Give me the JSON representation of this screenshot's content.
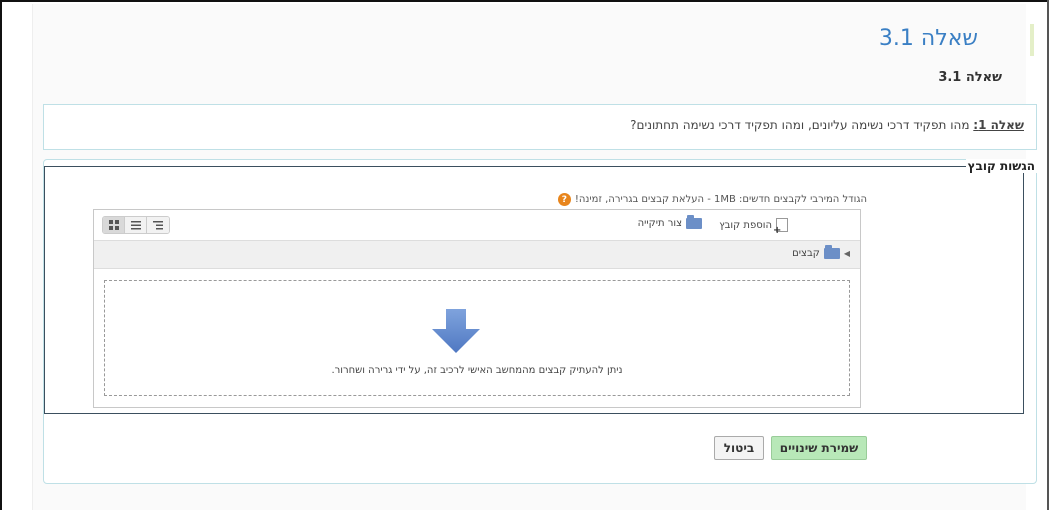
{
  "page": {
    "title": "שאלה 3.1",
    "subtitle": "שאלה 3.1"
  },
  "question": {
    "label": "שאלה 1:",
    "text": " מהו תפקיד דרכי נשימה עליונים, ומהו תפקיד דרכי נשימה תחתונים?"
  },
  "submission": {
    "legend": "הגשות קובץ",
    "size_note": "הגודל המירבי לקבצים חדשים: 1MB - העלאת קבצים בגרירה, זמינה!",
    "help_icon": "?",
    "toolbar": {
      "add_file": "הוספת קובץ",
      "create_folder": "צור תיקייה"
    },
    "path": {
      "folder": "קבצים"
    },
    "drop_text": "ניתן להעתיק קבצים מהמחשב האישי לרכיב זה, על ידי גרירה ושחרור."
  },
  "actions": {
    "save": "שמירת שינויים",
    "cancel": "ביטול"
  },
  "colors": {
    "title": "#3a7fc4",
    "save_button": "#b8e8b8",
    "arrow": "#6a8fcf",
    "border": "#bfe0e6"
  }
}
